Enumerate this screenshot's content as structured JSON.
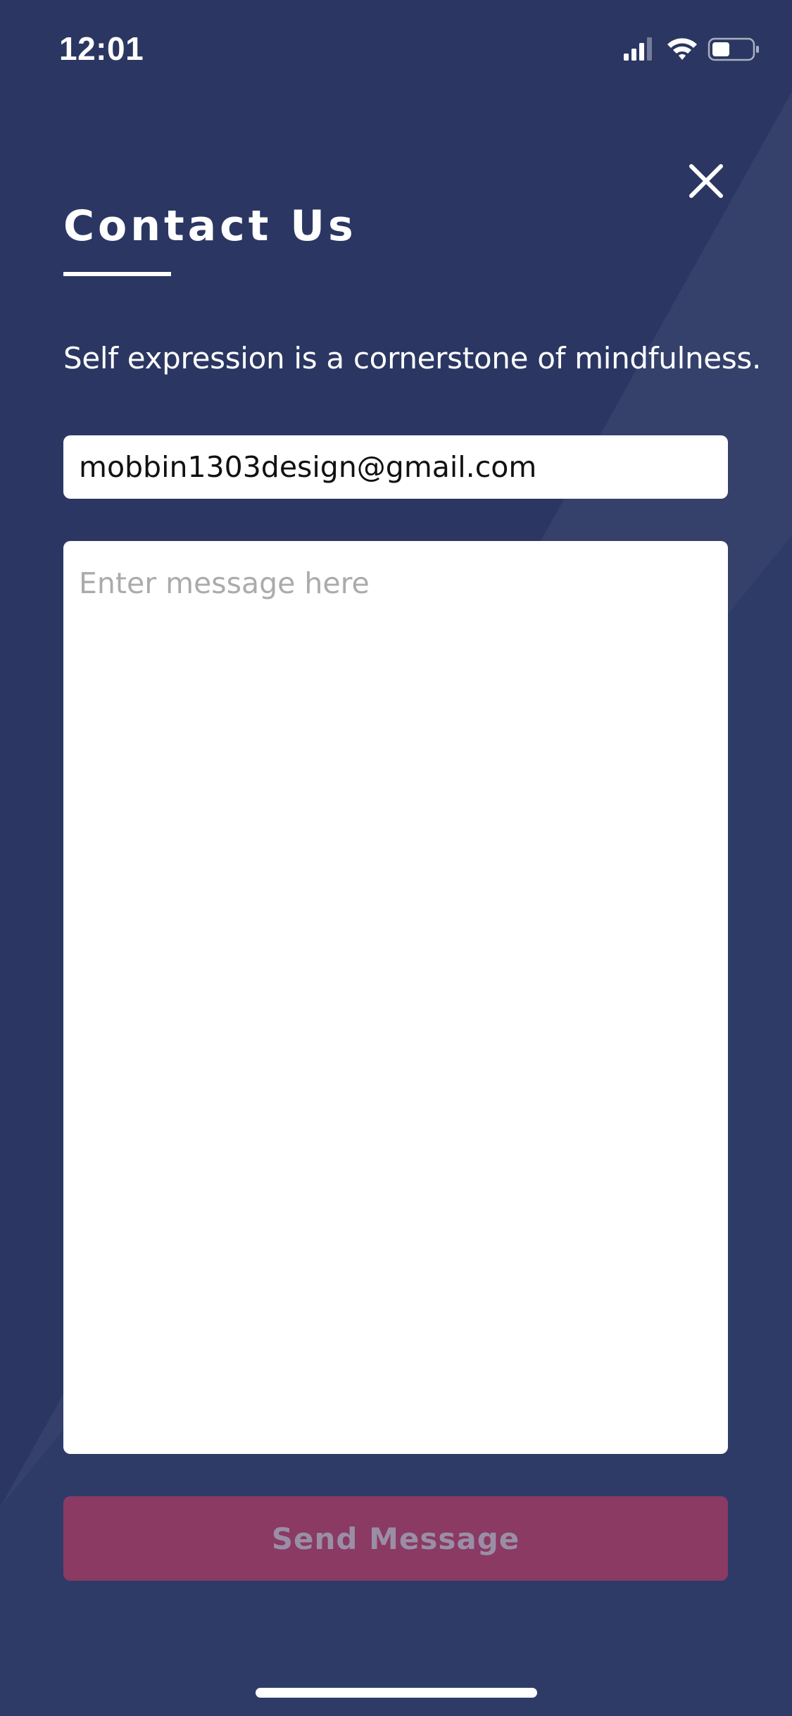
{
  "status_bar": {
    "time": "12:01",
    "signal_icon": "cellular-signal-icon",
    "wifi_icon": "wifi-icon",
    "battery_icon": "battery-icon"
  },
  "header": {
    "title": "Contact Us",
    "close_icon": "close-icon"
  },
  "tagline": "Self expression is a cornerstone of mindfulness.",
  "form": {
    "email_value": "mobbin1303design@gmail.com",
    "message_value": "",
    "message_placeholder": "Enter message here",
    "send_label": "Send Message"
  },
  "colors": {
    "background": "#2b3762",
    "background_highlight": "#3a4670",
    "button": "#8a3a63",
    "button_text": "#9a8ea6",
    "placeholder": "#ababab"
  }
}
